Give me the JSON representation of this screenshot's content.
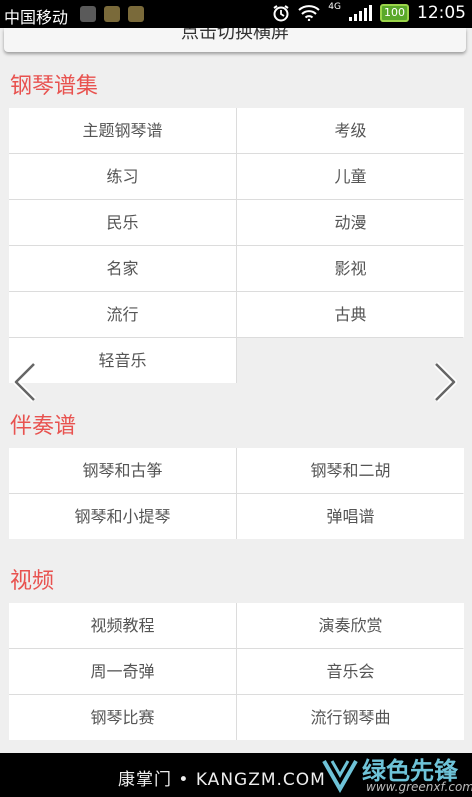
{
  "status": {
    "carrier": "中国移动",
    "network": "4G",
    "battery": "100",
    "time": "12:05"
  },
  "toggle": {
    "label": "点击切换横屏"
  },
  "sections": [
    {
      "title": "钢琴谱集",
      "items": [
        "主题钢琴谱",
        "考级",
        "练习",
        "儿童",
        "民乐",
        "动漫",
        "名家",
        "影视",
        "流行",
        "古典",
        "轻音乐"
      ]
    },
    {
      "title": "伴奏谱",
      "items": [
        "钢琴和古筝",
        "钢琴和二胡",
        "钢琴和小提琴",
        "弹唱谱"
      ]
    },
    {
      "title": "视频",
      "items": [
        "视频教程",
        "演奏欣赏",
        "周一奇弹",
        "音乐会",
        "钢琴比赛",
        "流行钢琴曲"
      ]
    }
  ],
  "footer": {
    "watermark": "康掌门 • KANGZM.COM",
    "brand": "绿色先锋",
    "brand_url": "www.greenxf.com"
  },
  "icons": [
    "status-notification-icon",
    "alarm-icon",
    "wifi-icon",
    "signal-icon",
    "battery-icon",
    "chevron-left-icon",
    "chevron-right-icon"
  ]
}
